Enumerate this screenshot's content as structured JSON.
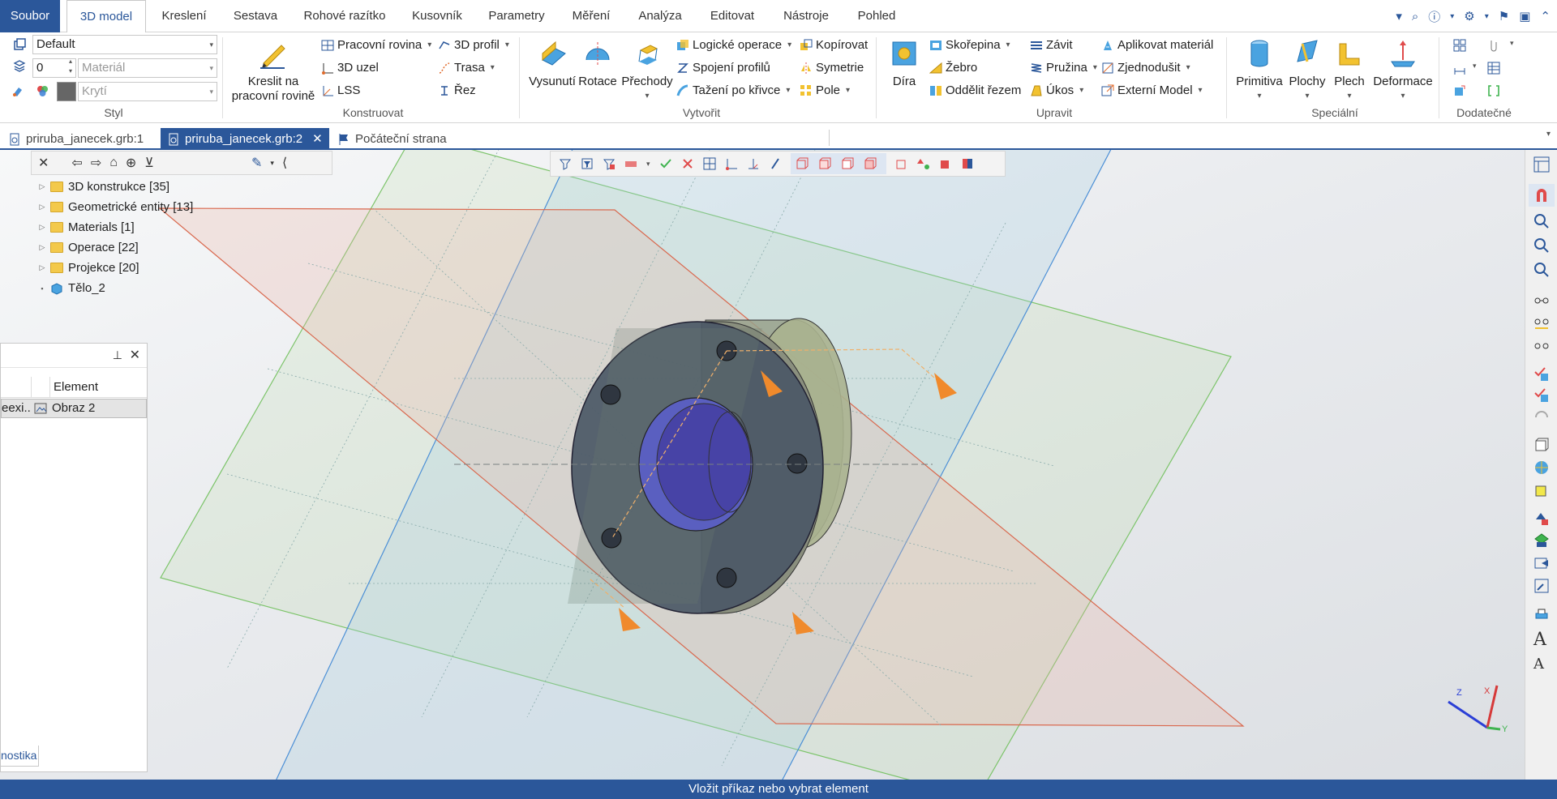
{
  "menu": {
    "tabs": [
      "Soubor",
      "3D model",
      "Kreslení",
      "Sestava",
      "Rohové razítko",
      "Kusovník",
      "Parametry",
      "Měření",
      "Analýza",
      "Editovat",
      "Nástroje",
      "Pohled"
    ]
  },
  "ribbon": {
    "styl": {
      "label": "Styl",
      "style_value": "Default",
      "layer_value": "0",
      "material_placeholder": "Materiál",
      "cover_placeholder": "Krytí"
    },
    "konstruovat": {
      "label": "Konstruovat",
      "draw_on_plane": "Kreslit na pracovní rovině",
      "work_plane": "Pracovní rovina",
      "node3d": "3D uzel",
      "lss": "LSS",
      "profile3d": "3D profil",
      "path": "Trasa",
      "cut": "Řez"
    },
    "vytvorit": {
      "label": "Vytvořit",
      "extrude": "Vysunutí",
      "rotate": "Rotace",
      "transitions": "Přechody",
      "logic_ops": "Logické operace",
      "profile_join": "Spojení profilů",
      "sweep": "Tažení po křivce",
      "copy": "Kopírovat",
      "symmetry": "Symetrie",
      "field": "Pole"
    },
    "upravit": {
      "label": "Upravit",
      "hole": "Díra",
      "shell": "Skořepina",
      "rib": "Žebro",
      "split": "Oddělit řezem",
      "thread": "Závit",
      "spring": "Pružina",
      "draft": "Úkos",
      "apply_material": "Aplikovat materiál",
      "simplify": "Zjednodušit",
      "external_model": "Externí Model"
    },
    "specialni": {
      "label": "Speciální",
      "primitive": "Primitiva",
      "surfaces": "Plochy",
      "sheet": "Plech",
      "deform": "Deformace"
    },
    "dodatecne": {
      "label": "Dodatečné"
    }
  },
  "doc_tabs": [
    {
      "label": "priruba_janecek.grb:1"
    },
    {
      "label": "priruba_janecek.grb:2"
    },
    {
      "label": "Počáteční strana"
    }
  ],
  "tree": {
    "items": [
      {
        "label": "3D konstrukce [35]"
      },
      {
        "label": "Geometrické entity [13]"
      },
      {
        "label": "Materials [1]"
      },
      {
        "label": "Operace [22]"
      },
      {
        "label": "Projekce [20]"
      },
      {
        "label": "Tělo_2"
      }
    ]
  },
  "panel": {
    "col_left": "",
    "col_element": "Element",
    "row_left": "eexi...",
    "row_element": "Obraz 2",
    "tab": "nostika"
  },
  "axis": {
    "x": "X",
    "y": "Y",
    "z": "Z"
  },
  "status": {
    "text": "Vložit příkaz nebo vybrat element"
  },
  "colors": {
    "accent": "#2b579a",
    "plane_red": "#e8a598",
    "plane_green": "#b8dba8",
    "plane_blue": "#a9cfe0",
    "part": "#4a5560",
    "bore": "#4b4aa8",
    "arrow": "#f08a2c"
  }
}
